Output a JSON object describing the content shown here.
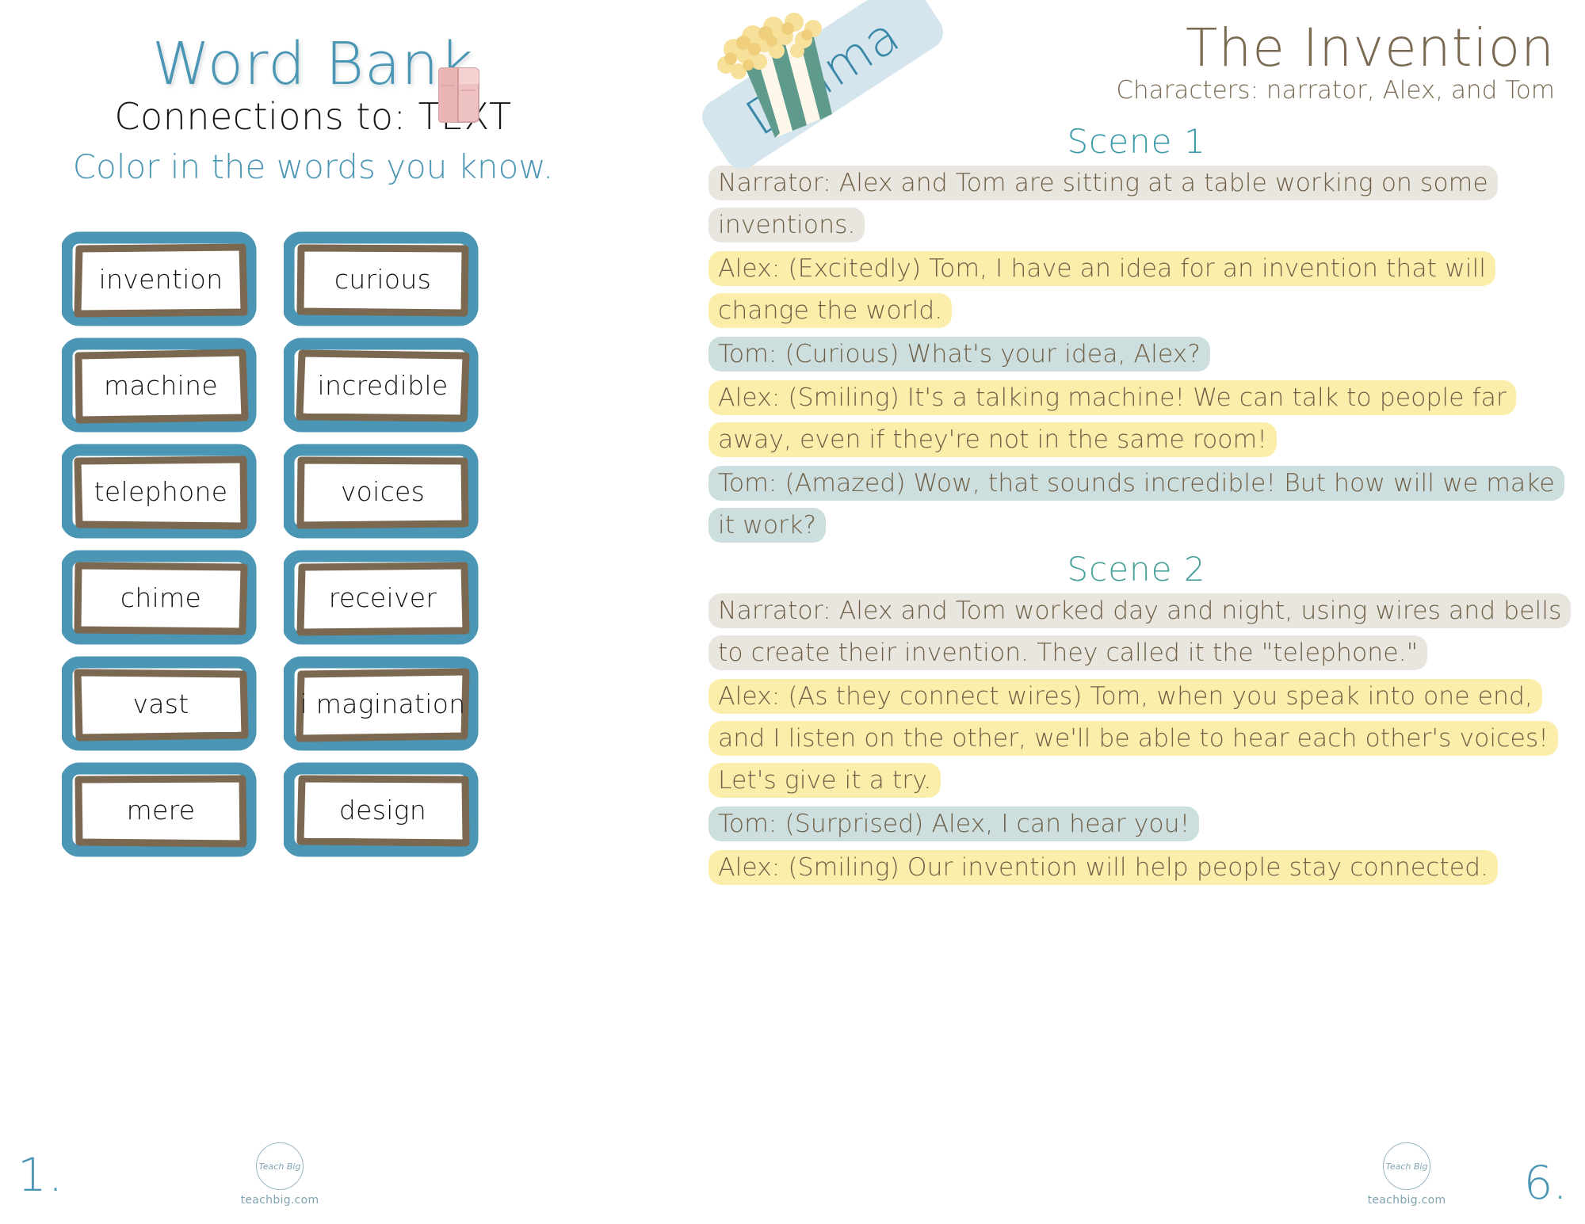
{
  "left_page": {
    "title": "Word Bank",
    "subtitle": "Connections to:  TEXT",
    "instruction": "Color in the words you know.",
    "book_icon": "book-icon",
    "page_number": "1.",
    "logo": {
      "mark": "Teach Big",
      "url": "teachbig.com"
    },
    "words": [
      "invention",
      "curious",
      "machine",
      "incredible",
      "telephone",
      "voices",
      "chime",
      "receiver",
      "vast",
      "i magination",
      "mere",
      "design"
    ]
  },
  "right_page": {
    "genre_badge": "Drama",
    "genre_icon": "popcorn-icon",
    "title": "The Invention",
    "characters": "Characters: narrator, Alex,  and Tom",
    "page_number": "6.",
    "logo": {
      "mark": "Teach Big",
      "url": "teachbig.com"
    },
    "scenes": [
      {
        "heading": "Scene 1",
        "lines": [
          {
            "speaker": "narrator",
            "text": "Narrator:  Alex and Tom are sitting at a table working on some inventions."
          },
          {
            "speaker": "alex",
            "text": "Alex: (Excitedly) Tom, I have an idea for an invention that will change the world."
          },
          {
            "speaker": "tom",
            "text": "Tom: (Curious) What's your idea, Alex?"
          },
          {
            "speaker": "alex",
            "text": "Alex: (Smiling) It's a talking machine! We can talk to people far away, even if they're not in the same room!"
          },
          {
            "speaker": "tom",
            "text": "Tom: (Amazed) Wow, that sounds incredible! But how will we make it work?"
          }
        ]
      },
      {
        "heading": "Scene 2",
        "lines": [
          {
            "speaker": "narrator",
            "text": "Narrator:  Alex and Tom worked day and night, using wires and bells to create their invention. They called it the \"telephone.\""
          },
          {
            "speaker": "alex",
            "text": "Alex: (As they connect wires) Tom, when you speak into one end, and I listen on the other, we'll be able to hear each other's voices! Let's give it a try."
          },
          {
            "speaker": "tom",
            "text": "Tom: (Surprised) Alex, I can hear you!"
          },
          {
            "speaker": "alex",
            "text": "Alex: (Smiling) Our invention will help people stay connected."
          }
        ]
      }
    ]
  },
  "colors": {
    "teal": "#4a96b4",
    "brown": "#7a6a52",
    "highlight_narrator": "#e9e5df",
    "highlight_alex": "#fbeeab",
    "highlight_tom": "#ccdede",
    "banner_blue": "#d4e5ed",
    "box_teal": "#4a96b4",
    "box_brown": "#7a6850"
  }
}
